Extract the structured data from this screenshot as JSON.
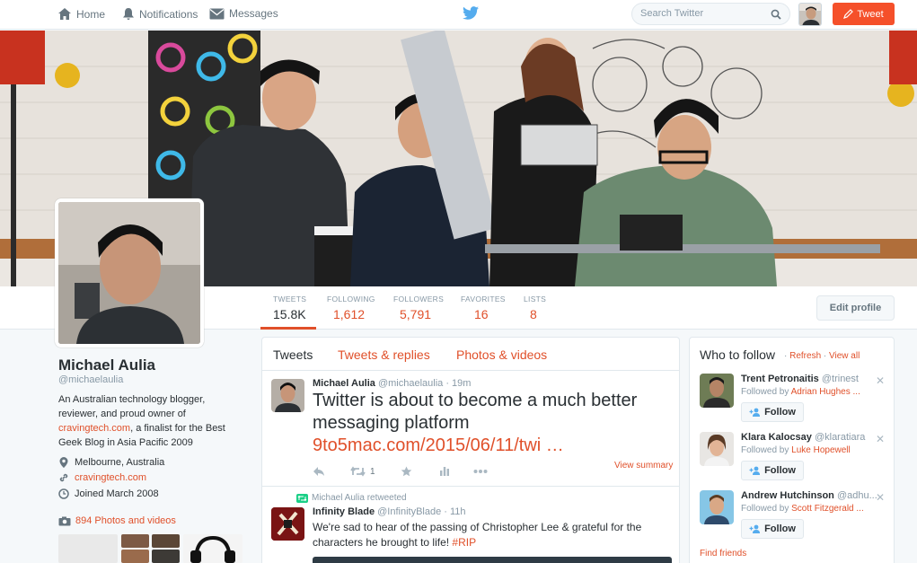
{
  "nav": {
    "home": "Home",
    "notifications": "Notifications",
    "messages": "Messages",
    "search_placeholder": "Search Twitter",
    "tweet_button": "Tweet",
    "brand_color": "#55acee",
    "accent_color": "#e0502a"
  },
  "stats": [
    {
      "label": "TWEETS",
      "value": "15.8K"
    },
    {
      "label": "FOLLOWING",
      "value": "1,612"
    },
    {
      "label": "FOLLOWERS",
      "value": "5,791"
    },
    {
      "label": "FAVORITES",
      "value": "16"
    },
    {
      "label": "LISTS",
      "value": "8"
    }
  ],
  "edit_profile": "Edit profile",
  "profile": {
    "name": "Michael Aulia",
    "handle": "@michaelaulia",
    "bio_1": "An Australian technology blogger, reviewer, and proud owner of",
    "bio_link": "cravingtech.com",
    "bio_2": ", a finalist for the Best Geek Blog in Asia Pacific 2009",
    "location": "Melbourne, Australia",
    "website": "cravingtech.com",
    "joined": "Joined March 2008",
    "photos": "894 Photos and videos"
  },
  "tabs": [
    "Tweets",
    "Tweets & replies",
    "Photos & videos"
  ],
  "tweets": [
    {
      "name": "Michael Aulia",
      "handle": "@michaelaulia",
      "time": "19m",
      "text": "Twitter is about to become a much better messaging platform ",
      "link": "9to5mac.com/2015/06/11/twi …",
      "retweets": "1",
      "view_summary": "View summary"
    },
    {
      "retweeted_by": "Michael Aulia retweeted",
      "name": "Infinity Blade",
      "handle": "@InfinityBlade",
      "time": "11h",
      "text": "We're sad to hear of the passing of Christopher Lee & grateful for the characters he brought to life! ",
      "hashtag": "#RIP"
    }
  ],
  "who_to_follow": {
    "title": "Who to follow",
    "refresh": "Refresh",
    "view_all": "View all",
    "follow_label": "Follow",
    "find_friends": "Find friends",
    "suggestions": [
      {
        "name": "Trent Petronaitis",
        "handle": "@trinest",
        "followed_prefix": "Followed by ",
        "followed_by": "Adrian Hughes ..."
      },
      {
        "name": "Klara Kalocsay",
        "handle": "@klaratiara",
        "followed_prefix": "Followed by ",
        "followed_by": "Luke Hopewell"
      },
      {
        "name": "Andrew Hutchinson",
        "handle": "@adhu...",
        "followed_prefix": "Followed by ",
        "followed_by": "Scott Fitzgerald ..."
      }
    ]
  }
}
